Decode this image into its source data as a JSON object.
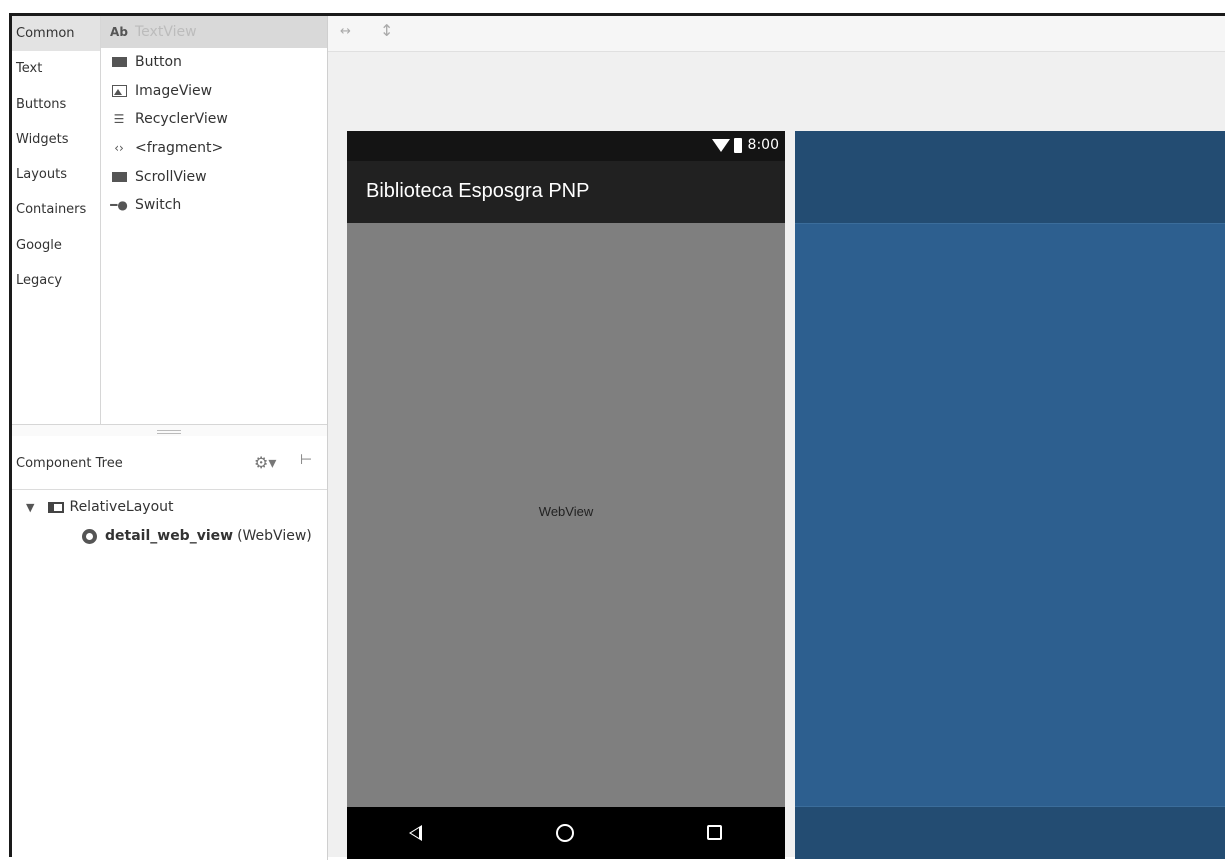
{
  "palette": {
    "categories": [
      "Common",
      "Text",
      "Buttons",
      "Widgets",
      "Layouts",
      "Containers",
      "Google",
      "Legacy"
    ],
    "selected_category": "Common",
    "items": [
      {
        "label": "TextView",
        "icon": "text-ab-icon",
        "prefix": "Ab"
      },
      {
        "label": "Button",
        "icon": "button-icon"
      },
      {
        "label": "ImageView",
        "icon": "image-icon"
      },
      {
        "label": "RecyclerView",
        "icon": "list-icon"
      },
      {
        "label": "<fragment>",
        "icon": "code-brackets-icon"
      },
      {
        "label": "ScrollView",
        "icon": "scroll-icon"
      },
      {
        "label": "Switch",
        "icon": "switch-icon"
      }
    ]
  },
  "component_tree": {
    "title": "Component Tree",
    "root": {
      "label": "RelativeLayout",
      "icon": "relative-layout-icon"
    },
    "child": {
      "id": "detail_web_view",
      "type": "(WebView)",
      "icon": "webview-icon"
    }
  },
  "phone": {
    "time": "8:00",
    "app_title": "Biblioteca Esposgra PNP",
    "webview_label": "WebView"
  },
  "colors": {
    "blueprint": "#2d5f8f",
    "app_bar": "#212121",
    "webview": "#7f7f7f"
  }
}
